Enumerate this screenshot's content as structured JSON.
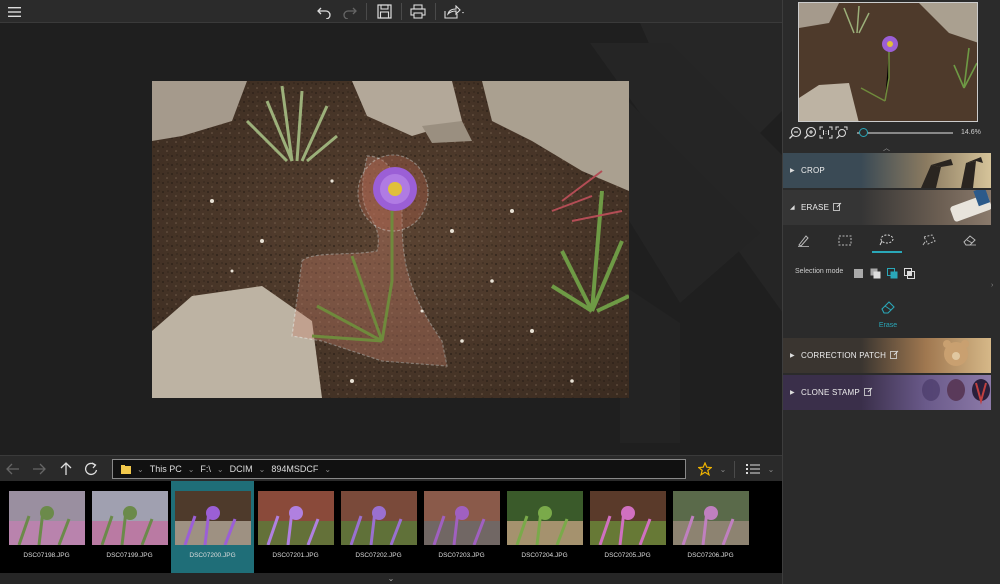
{
  "toolbar": {
    "menu_icon": "hamburger-menu-icon",
    "undo_icon": "undo-icon",
    "redo_icon": "redo-icon",
    "save_icon": "save-icon",
    "print_icon": "print-icon",
    "share_icon": "share-icon"
  },
  "navigation": {
    "back_icon": "arrow-left-icon",
    "forward_icon": "arrow-right-icon",
    "up_icon": "arrow-up-icon",
    "refresh_icon": "refresh-icon",
    "breadcrumbs": [
      "This PC",
      "F:\\",
      "DCIM",
      "894MSDCF"
    ],
    "favorite_icon": "star-icon",
    "view_icon": "list-view-icon"
  },
  "filmstrip": [
    {
      "name": "DSC07198.JPG",
      "selected": false
    },
    {
      "name": "DSC07199.JPG",
      "selected": false
    },
    {
      "name": "DSC07200.JPG",
      "selected": true
    },
    {
      "name": "DSC07201.JPG",
      "selected": false
    },
    {
      "name": "DSC07202.JPG",
      "selected": false
    },
    {
      "name": "DSC07203.JPG",
      "selected": false
    },
    {
      "name": "DSC07204.JPG",
      "selected": false
    },
    {
      "name": "DSC07205.JPG",
      "selected": false
    },
    {
      "name": "DSC07206.JPG",
      "selected": false
    }
  ],
  "panel": {
    "zoom_value": "14.6%",
    "crop_label": "CROP",
    "erase_label": "ERASE",
    "selection_mode_label": "Selection mode",
    "erase_action_label": "Erase",
    "correction_patch_label": "CORRECTION PATCH",
    "clone_stamp_label": "CLONE STAMP"
  },
  "colors": {
    "accent": "#2aa7b8",
    "favorite": "#f0b400",
    "selected_thumb": "#1f6e78"
  }
}
